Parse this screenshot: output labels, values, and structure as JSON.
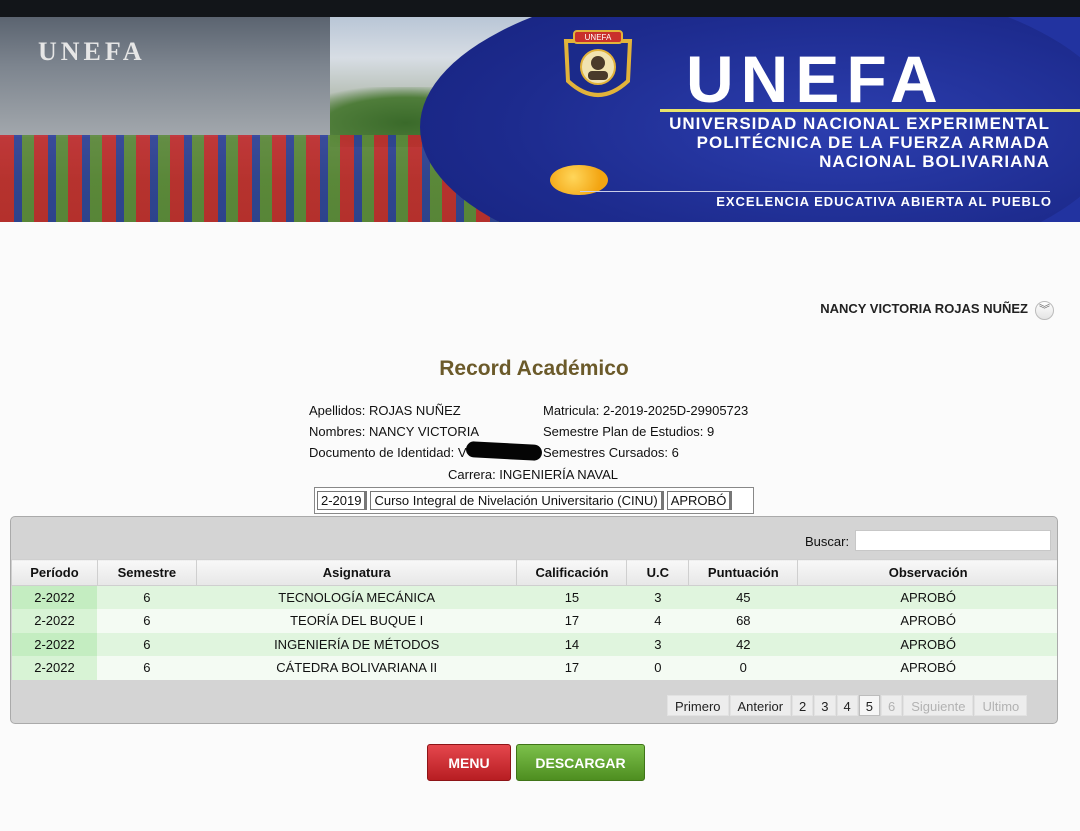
{
  "banner": {
    "building_sign": "UNEFA",
    "brand": "UNEFA",
    "university_lines": [
      "UNIVERSIDAD NACIONAL EXPERIMENTAL",
      "POLITÉCNICA DE LA FUERZA ARMADA",
      "NACIONAL BOLIVARIANA"
    ],
    "slogan": "EXCELENCIA EDUCATIVA ABIERTA AL PUEBLO",
    "crest_label": "UNEFA"
  },
  "user": {
    "name": "NANCY VICTORIA ROJAS NUÑEZ",
    "menu_icon": "chevron-down-icon",
    "menu_glyph": "︾"
  },
  "page": {
    "title": "Record Académico"
  },
  "student": {
    "apellidos": "Apellidos: ROJAS NUÑEZ",
    "nombres": "Nombres: NANCY VICTORIA",
    "documento": "Documento de Identidad: V",
    "matricula": "Matricula: 2-2019-2025D-29905723",
    "semestre_plan": "Semestre Plan de Estudios: 9",
    "semestres_cursados": "Semestres Cursados: 6",
    "carrera": "Carrera: INGENIERÍA NAVAL"
  },
  "cinu": {
    "periodo": "2-2019",
    "curso": "Curso Integral de Nivelación Universitario (CINU)",
    "estado": "APROBÓ"
  },
  "search": {
    "label": "Buscar:",
    "value": ""
  },
  "table": {
    "headers": [
      "Período",
      "Semestre",
      "Asignatura",
      "Calificación",
      "U.C",
      "Puntuación",
      "Observación"
    ],
    "rows": [
      [
        "2-2022",
        "6",
        "TECNOLOGÍA MECÁNICA",
        "15",
        "3",
        "45",
        "APROBÓ"
      ],
      [
        "2-2022",
        "6",
        "TEORÍA DEL BUQUE I",
        "17",
        "4",
        "68",
        "APROBÓ"
      ],
      [
        "2-2022",
        "6",
        "INGENIERÍA DE MÉTODOS",
        "14",
        "3",
        "42",
        "APROBÓ"
      ],
      [
        "2-2022",
        "6",
        "CÁTEDRA BOLIVARIANA II",
        "17",
        "0",
        "0",
        "APROBÓ"
      ]
    ]
  },
  "pager": {
    "first": "Primero",
    "prev": "Anterior",
    "pages": [
      "2",
      "3",
      "4",
      "5",
      "6"
    ],
    "current": "5",
    "next": "Siguiente",
    "last": "Ultimo"
  },
  "buttons": {
    "menu": "MENU",
    "download": "DESCARGAR"
  },
  "colors": {
    "title": "#6b5a2a",
    "menu_button": "#d0343a",
    "download_button": "#66a835",
    "row_highlight": "#e0f5de"
  }
}
